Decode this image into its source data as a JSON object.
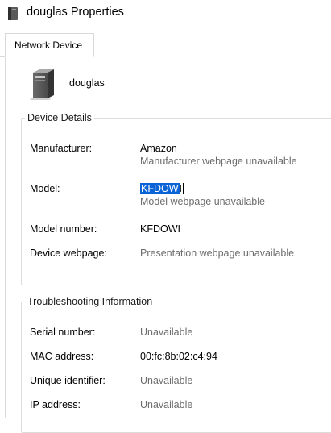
{
  "window": {
    "title": "douglas Properties"
  },
  "tabs": [
    {
      "label": "Network Device"
    }
  ],
  "device": {
    "name": "douglas"
  },
  "device_details": {
    "legend": "Device Details",
    "manufacturer": {
      "label": "Manufacturer:",
      "value": "Amazon",
      "sub": "Manufacturer webpage unavailable"
    },
    "model": {
      "label": "Model:",
      "value_selected": "KFDOW",
      "value_rest": "I",
      "sub": "Model webpage unavailable"
    },
    "model_number": {
      "label": "Model number:",
      "value": "KFDOWI"
    },
    "device_webpage": {
      "label": "Device webpage:",
      "value": "Presentation webpage unavailable"
    }
  },
  "troubleshooting": {
    "legend": "Troubleshooting Information",
    "serial_number": {
      "label": "Serial number:",
      "value": "Unavailable"
    },
    "mac_address": {
      "label": "MAC address:",
      "value": "00:fc:8b:02:c4:94"
    },
    "unique_identifier": {
      "label": "Unique identifier:",
      "value": "Unavailable"
    },
    "ip_address": {
      "label": "IP address:",
      "value": "Unavailable"
    }
  },
  "icons": {
    "title": "device-tower-icon",
    "device": "device-tower-icon"
  },
  "colors": {
    "selection": "#0a64d6",
    "muted_text": "#6d6d6d",
    "border": "#dcdcdc"
  }
}
